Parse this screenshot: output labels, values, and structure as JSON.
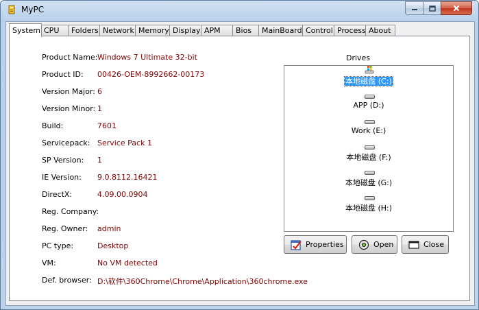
{
  "window": {
    "title": "MyPC"
  },
  "tabs": [
    {
      "label": "System",
      "active": true
    },
    {
      "label": "CPU"
    },
    {
      "label": "Folders"
    },
    {
      "label": "Network"
    },
    {
      "label": "Memory"
    },
    {
      "label": "Display"
    },
    {
      "label": "APM"
    },
    {
      "label": "Bios"
    },
    {
      "label": "MainBoard"
    },
    {
      "label": "Control"
    },
    {
      "label": "Process"
    },
    {
      "label": "About"
    }
  ],
  "system_info": [
    {
      "label": "Product Name:",
      "value": "Windows 7 Ultimate 32-bit"
    },
    {
      "label": "Product ID:",
      "value": "00426-OEM-8992662-00173"
    },
    {
      "label": "Version Major:",
      "value": "6"
    },
    {
      "label": "Version Minor:",
      "value": "1"
    },
    {
      "label": "Build:",
      "value": "7601"
    },
    {
      "label": "Servicepack:",
      "value": "Service Pack 1"
    },
    {
      "label": "SP Version:",
      "value": "1"
    },
    {
      "label": "IE Version:",
      "value": "9.0.8112.16421"
    },
    {
      "label": "DirectX:",
      "value": "4.09.00.0904"
    },
    {
      "label": "Reg. Company:",
      "value": ""
    },
    {
      "label": "Reg. Owner:",
      "value": "admin"
    },
    {
      "label": "PC type:",
      "value": "Desktop"
    },
    {
      "label": "VM:",
      "value": "No VM detected"
    },
    {
      "label": "Def. browser:",
      "value": "D:\\软件\\360Chrome\\Chrome\\Application\\360chrome.exe"
    }
  ],
  "drives": {
    "label": "Drives",
    "items": [
      {
        "name": "本地磁盘 (C:)",
        "icon": "windows-drive-icon",
        "selected": true
      },
      {
        "name": "APP (D:)",
        "icon": "hard-drive-icon"
      },
      {
        "name": "Work (E:)",
        "icon": "hard-drive-icon"
      },
      {
        "name": "本地磁盘 (F:)",
        "icon": "hard-drive-icon"
      },
      {
        "name": "本地磁盘 (G:)",
        "icon": "hard-drive-icon"
      },
      {
        "name": "本地磁盘 (H:)",
        "icon": "hard-drive-icon"
      }
    ]
  },
  "buttons": {
    "properties": "Properties",
    "open": "Open",
    "close": "Close"
  },
  "colors": {
    "value_text": "#800000",
    "selection": "#3399ff"
  }
}
